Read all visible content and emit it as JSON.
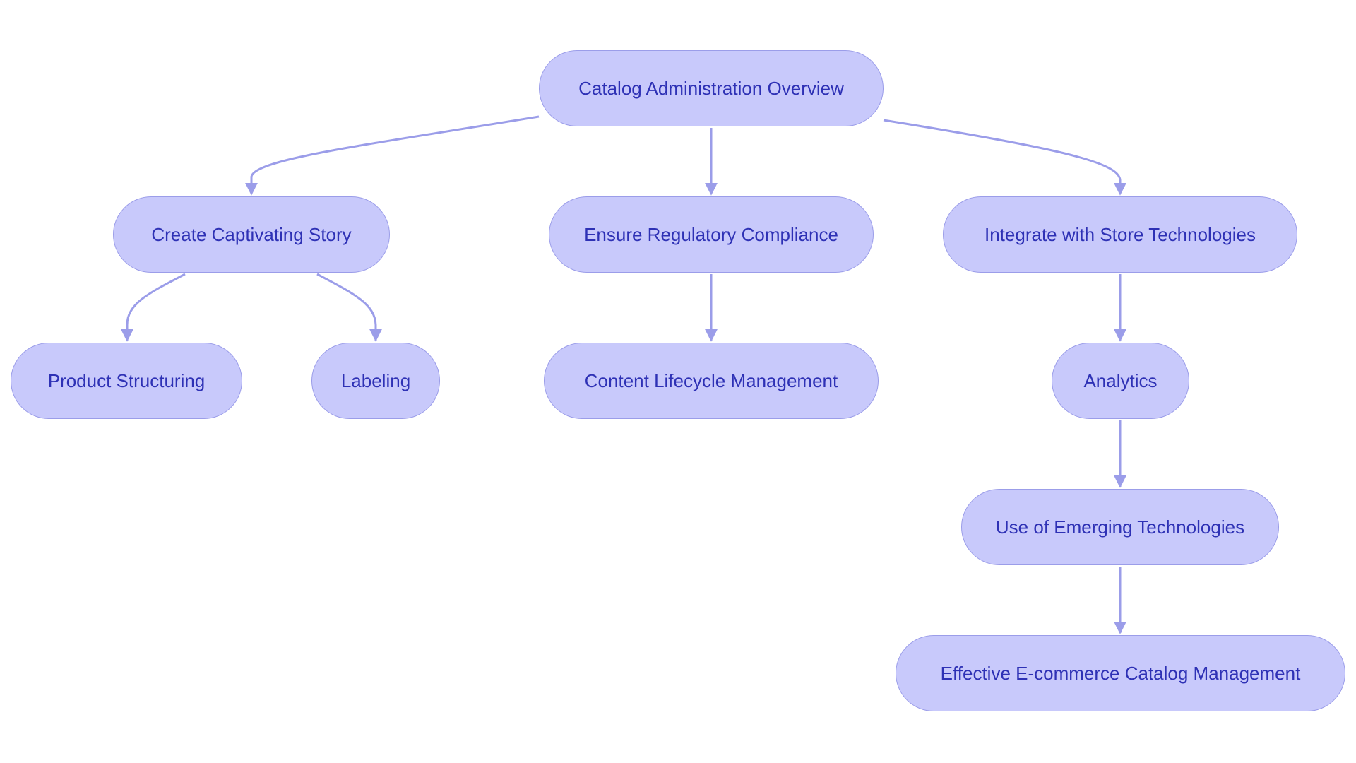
{
  "diagram": {
    "type": "flowchart",
    "colors": {
      "node_fill": "#c8c9fb",
      "node_border": "#9b9de9",
      "edge": "#9b9de9",
      "text": "#2e31b5"
    },
    "nodes": [
      {
        "id": "root",
        "label": "Catalog Administration Overview"
      },
      {
        "id": "story",
        "label": "Create Captivating Story"
      },
      {
        "id": "compliance",
        "label": "Ensure Regulatory Compliance"
      },
      {
        "id": "integrate",
        "label": "Integrate with Store Technologies"
      },
      {
        "id": "structuring",
        "label": "Product Structuring"
      },
      {
        "id": "labeling",
        "label": "Labeling"
      },
      {
        "id": "lifecycle",
        "label": "Content Lifecycle Management"
      },
      {
        "id": "analytics",
        "label": "Analytics"
      },
      {
        "id": "emerging",
        "label": "Use of Emerging Technologies"
      },
      {
        "id": "effective",
        "label": "Effective E-commerce Catalog Management"
      }
    ],
    "edges": [
      {
        "from": "root",
        "to": "story"
      },
      {
        "from": "root",
        "to": "compliance"
      },
      {
        "from": "root",
        "to": "integrate"
      },
      {
        "from": "story",
        "to": "structuring"
      },
      {
        "from": "story",
        "to": "labeling"
      },
      {
        "from": "compliance",
        "to": "lifecycle"
      },
      {
        "from": "integrate",
        "to": "analytics"
      },
      {
        "from": "analytics",
        "to": "emerging"
      },
      {
        "from": "emerging",
        "to": "effective"
      }
    ]
  }
}
